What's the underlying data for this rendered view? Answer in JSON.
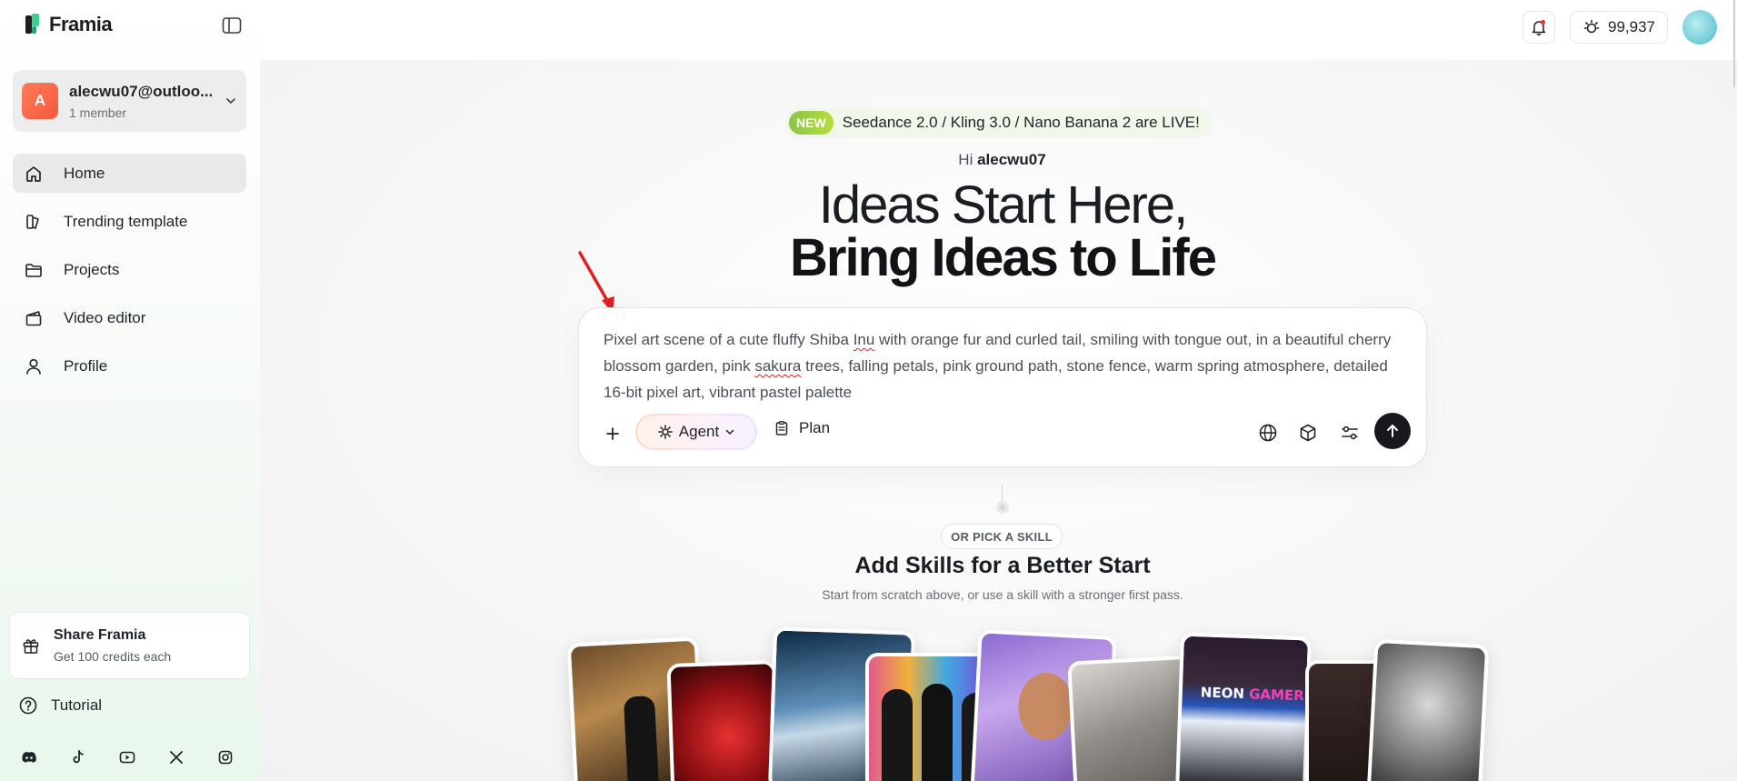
{
  "app": {
    "name": "Framia"
  },
  "workspace": {
    "avatar_letter": "A",
    "name": "alecwu07@outloo...",
    "members": "1 member"
  },
  "nav": [
    {
      "label": "Home",
      "icon": "home-icon",
      "active": true
    },
    {
      "label": "Trending template",
      "icon": "template-icon",
      "active": false
    },
    {
      "label": "Projects",
      "icon": "folder-icon",
      "active": false
    },
    {
      "label": "Video editor",
      "icon": "clapperboard-icon",
      "active": false
    },
    {
      "label": "Profile",
      "icon": "user-icon",
      "active": false
    }
  ],
  "share": {
    "title": "Share Framia",
    "subtitle": "Get 100 credits each"
  },
  "tutorial": {
    "label": "Tutorial"
  },
  "socials": [
    "discord-icon",
    "tiktok-icon",
    "youtube-icon",
    "x-icon",
    "instagram-icon"
  ],
  "topbar": {
    "credits": "99,937"
  },
  "announcement": {
    "badge": "NEW",
    "text": "Seedance 2.0 / Kling 3.0 / Nano Banana 2 are LIVE!"
  },
  "hero": {
    "greeting_prefix": "Hi",
    "username": "alecwu07",
    "line1": "Ideas Start Here,",
    "line2": "Bring Ideas to Life"
  },
  "prompt": {
    "text_a": "Pixel art scene of a cute fluffy Shiba ",
    "text_b": "Inu",
    "text_c": " with orange fur and curled tail, smiling with tongue out, in a beautiful cherry blossom garden, pink ",
    "text_d": "sakura",
    "text_e": " trees, falling petals, pink ground path, stone fence, warm spring atmosphere, detailed 16-bit pixel art, vibrant pastel palette",
    "agent_label": "Agent",
    "plan_label": "Plan"
  },
  "skills": {
    "pill": "OR PICK A SKILL",
    "title": "Add Skills for a Better Start",
    "subtitle": "Start from scratch above, or use a skill with a stronger first pass."
  },
  "colors": {
    "accent_green": "#8bc34a",
    "send_button": "#17191c",
    "active_nav": "#e9e9e9",
    "arrow": "#e02020"
  }
}
